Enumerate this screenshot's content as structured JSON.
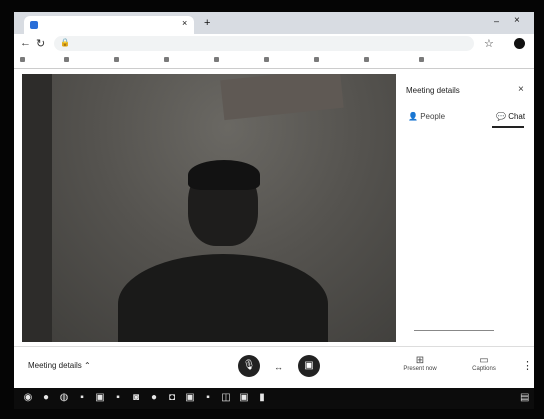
{
  "browser": {
    "tab_title": "",
    "new_tab": "+",
    "tab_close": "×",
    "min": "–",
    "close": "×",
    "url": "",
    "bookmarks": [
      "",
      "",
      "",
      "",
      "",
      "",
      "",
      "",
      ""
    ]
  },
  "meeting": {
    "self_name": "",
    "details_label": "Meeting details ⌃",
    "end_call_separator": "↔"
  },
  "side_panel": {
    "title": "Meeting details",
    "tabs": {
      "people": "People",
      "chat": "Chat"
    },
    "messages": [
      {
        "sender": "",
        "time": "",
        "text": ""
      },
      {
        "sender": "",
        "time": "",
        "text": ""
      },
      {
        "sender": "",
        "time": "",
        "text": ""
      },
      {
        "sender": "",
        "time": "",
        "text": ""
      }
    ]
  },
  "bottom_bar": {
    "present_label": "Present now",
    "present_icon": "present-icon",
    "captions_label": "Captions",
    "captions_icon": "captions-icon",
    "more_icon": "⋮"
  },
  "taskbar": {
    "clock": ""
  },
  "colors": {
    "frame": "#050505",
    "tab_strip": "#d8dce2",
    "taskbar": "#0c0c0c",
    "video_bg": "#55534f"
  }
}
